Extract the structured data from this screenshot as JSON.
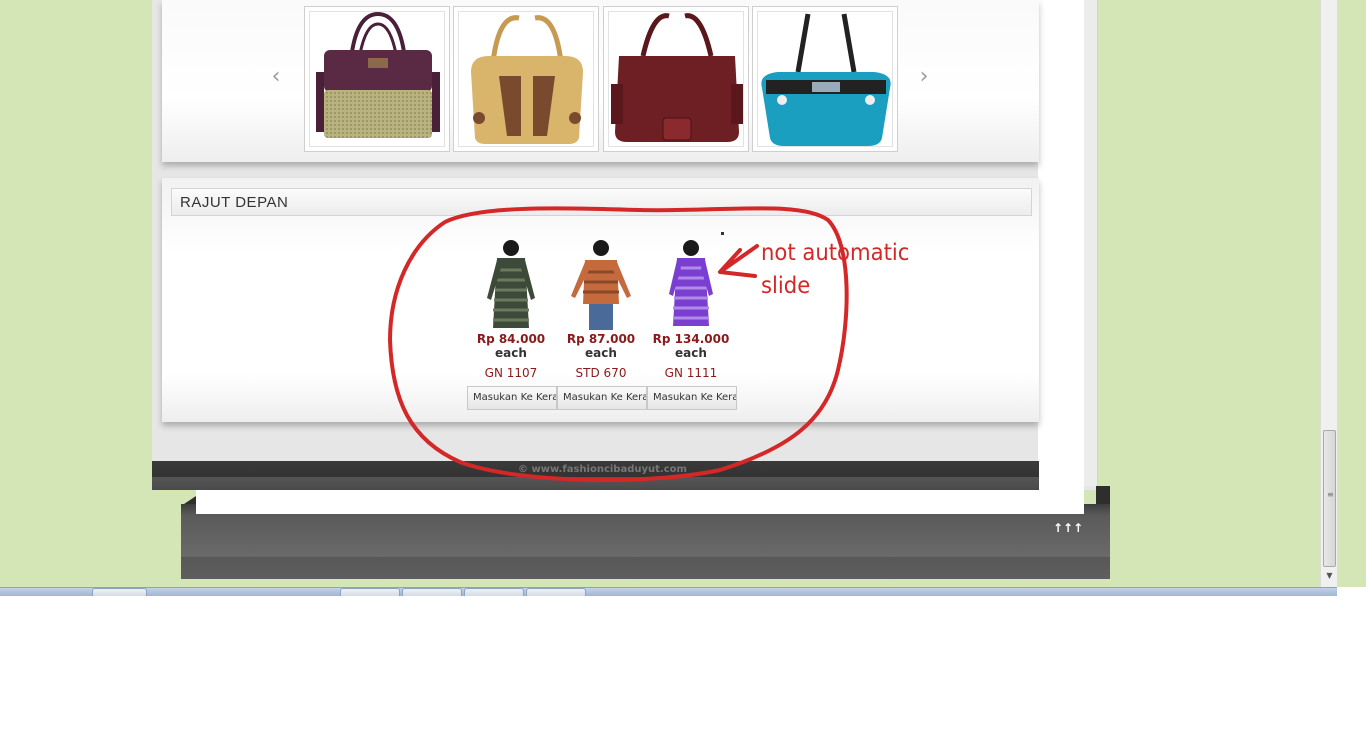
{
  "carousel": {
    "prev_label": "‹",
    "next_label": "›",
    "images": [
      {
        "name": "purple-woven-handbag",
        "color": "#5a2a44",
        "accent": "#b7b27e"
      },
      {
        "name": "tan-handbag",
        "color": "#d9b46b",
        "accent": "#7a4a2e"
      },
      {
        "name": "maroon-handbag",
        "color": "#6d1f24",
        "accent": "#8a2a2f"
      },
      {
        "name": "teal-handbag",
        "color": "#1a9fc0",
        "accent": "#222222"
      }
    ]
  },
  "section": {
    "title": "RAJUT DEPAN"
  },
  "products": [
    {
      "price": "Rp 84.000",
      "unit": "each",
      "code": "GN 1107",
      "cart_label": "Masukan Ke Keranjang",
      "color": "#3d4a3a",
      "stripe": "#6b7a5e"
    },
    {
      "price": "Rp 87.000",
      "unit": "each",
      "code": "STD 670",
      "cart_label": "Masukan Ke Keranjang",
      "color": "#c46a3c",
      "stripe": "#8a4a2a"
    },
    {
      "price": "Rp 134.000",
      "unit": "each",
      "code": "GN 1111",
      "cart_label": "Masukan Ke Keranjang",
      "color": "#7a3fd0",
      "stripe": "#b28ae8"
    }
  ],
  "footer": {
    "copyright": "© www.fashioncibaduyut.com",
    "to_top_label": "↑↑↑"
  },
  "annotation": {
    "line1": "not automatic",
    "line2": "slide",
    "color": "#d42828"
  }
}
